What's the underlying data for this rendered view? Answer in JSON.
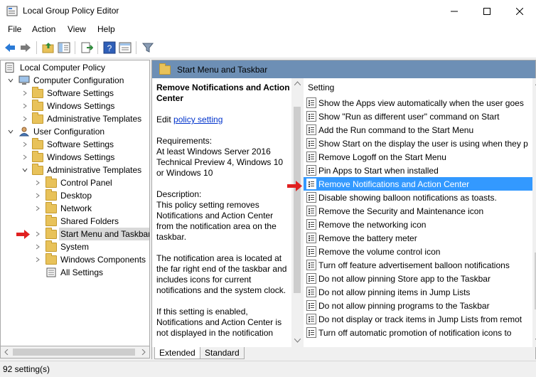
{
  "window": {
    "title": "Local Group Policy Editor",
    "accent": "#3399ff"
  },
  "menu": {
    "file": "File",
    "action": "Action",
    "view": "View",
    "help": "Help"
  },
  "tree": {
    "items": [
      {
        "label": "Local Computer Policy"
      },
      {
        "label": "Computer Configuration"
      },
      {
        "label": "Software Settings"
      },
      {
        "label": "Windows Settings"
      },
      {
        "label": "Administrative Templates"
      },
      {
        "label": "User Configuration"
      },
      {
        "label": "Software Settings"
      },
      {
        "label": "Windows Settings"
      },
      {
        "label": "Administrative Templates"
      },
      {
        "label": "Control Panel"
      },
      {
        "label": "Desktop"
      },
      {
        "label": "Network"
      },
      {
        "label": "Shared Folders"
      },
      {
        "label": "Start Menu and Taskbar"
      },
      {
        "label": "System"
      },
      {
        "label": "Windows Components"
      },
      {
        "label": "All Settings"
      }
    ]
  },
  "header": {
    "title": "Start Menu and Taskbar"
  },
  "description": {
    "title": "Remove Notifications and Action Center",
    "edit_prefix": "Edit",
    "edit_link": "policy setting",
    "requirements": "Requirements:\nAt least Windows Server 2016 Technical Preview 4, Windows 10 or Windows 10",
    "description_heading": "Description:",
    "description_body": "This policy setting removes Notifications and Action Center from the notification area on the taskbar.",
    "paragraph2": "The notification area is located at the far right end of the taskbar and includes icons for current notifications and the system clock.",
    "paragraph3": "If this setting is enabled, Notifications and Action Center is not displayed in the notification"
  },
  "list": {
    "column_header": "Setting",
    "rows": [
      "Show the Apps view automatically when the user goes",
      "Show \"Run as different user\" command on Start",
      "Add the Run command to the Start Menu",
      "Show Start on the display the user is using when they p",
      "Remove Logoff on the Start Menu",
      "Pin Apps to Start when installed",
      "Remove Notifications and Action Center",
      "Disable showing balloon notifications as toasts.",
      "Remove the Security and Maintenance icon",
      "Remove the networking icon",
      "Remove the battery meter",
      "Remove the volume control icon",
      "Turn off feature advertisement balloon notifications",
      "Do not allow pinning Store app to the Taskbar",
      "Do not allow pinning items in Jump Lists",
      "Do not allow pinning programs to the Taskbar",
      "Do not display or track items in Jump Lists from remot",
      "Turn off automatic promotion of notification icons to"
    ],
    "selected_index": 6
  },
  "tabs": {
    "extended": "Extended",
    "standard": "Standard"
  },
  "status": {
    "text": "92 setting(s)"
  }
}
